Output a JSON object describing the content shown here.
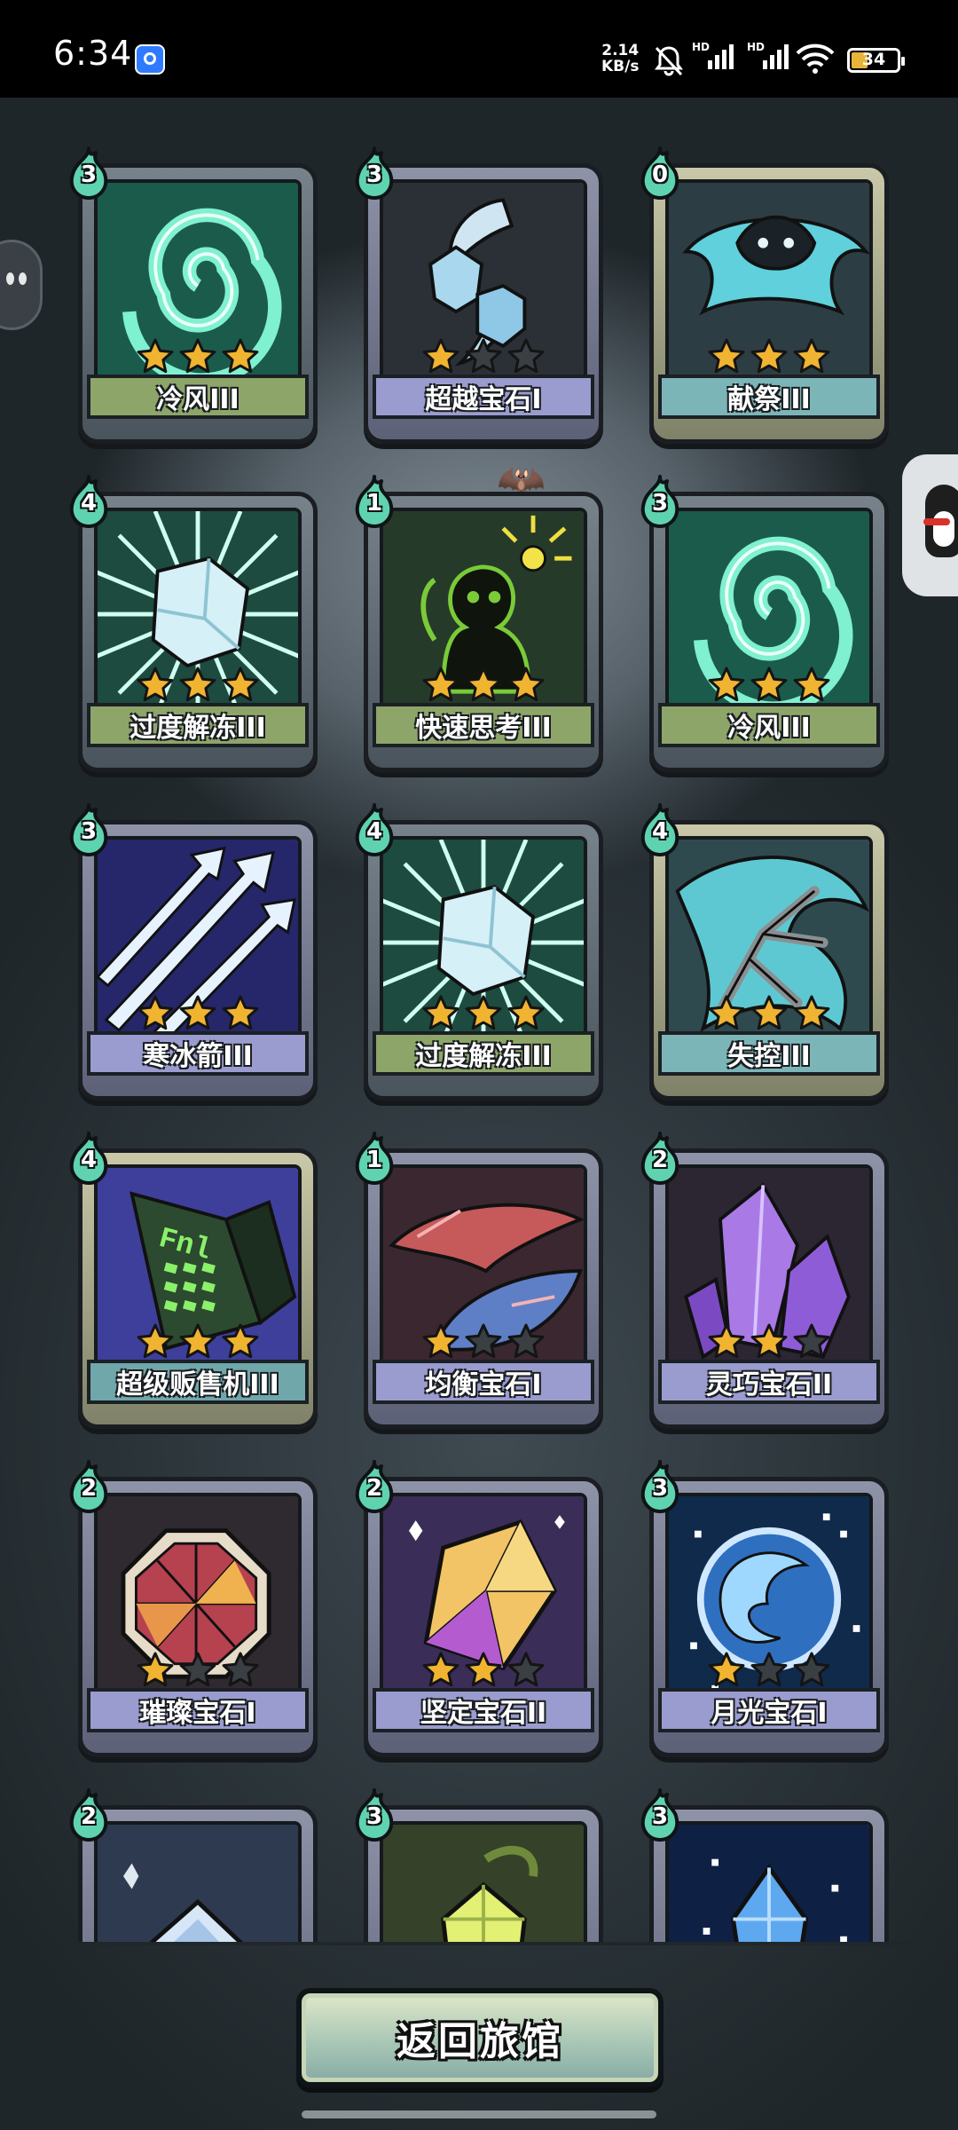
{
  "status_bar": {
    "time": "6:34",
    "net_speed_value": "2.14",
    "net_speed_unit": "KB/s",
    "signal_labels": [
      "HD",
      "HD"
    ],
    "battery_level": "34"
  },
  "cards": [
    {
      "name": "冷风III",
      "cost": "3",
      "stars": 3,
      "max_stars": 3,
      "rarity": "green",
      "art": "vortex"
    },
    {
      "name": "超越宝石I",
      "cost": "3",
      "stars": 1,
      "max_stars": 3,
      "rarity": "purple",
      "art": "gem-pair"
    },
    {
      "name": "献祭III",
      "cost": "0",
      "stars": 3,
      "max_stars": 3,
      "rarity": "gold",
      "art": "spirit"
    },
    {
      "name": "过度解冻III",
      "cost": "4",
      "stars": 3,
      "max_stars": 3,
      "rarity": "green",
      "art": "ice-cube"
    },
    {
      "name": "快速思考III",
      "cost": "1",
      "stars": 3,
      "max_stars": 3,
      "rarity": "green",
      "art": "thinker"
    },
    {
      "name": "冷风III",
      "cost": "3",
      "stars": 3,
      "max_stars": 3,
      "rarity": "green",
      "art": "vortex"
    },
    {
      "name": "寒冰箭III",
      "cost": "3",
      "stars": 3,
      "max_stars": 3,
      "rarity": "purple",
      "art": "ice-arrows"
    },
    {
      "name": "过度解冻III",
      "cost": "4",
      "stars": 3,
      "max_stars": 3,
      "rarity": "green",
      "art": "ice-cube"
    },
    {
      "name": "失控III",
      "cost": "4",
      "stars": 3,
      "max_stars": 3,
      "rarity": "gold",
      "art": "claw"
    },
    {
      "name": "超级贩售机III",
      "cost": "4",
      "stars": 3,
      "max_stars": 3,
      "rarity": "gold-teal",
      "art": "vending"
    },
    {
      "name": "均衡宝石I",
      "cost": "1",
      "stars": 1,
      "max_stars": 3,
      "rarity": "purple",
      "art": "balance-gem"
    },
    {
      "name": "灵巧宝石II",
      "cost": "2",
      "stars": 2,
      "max_stars": 3,
      "rarity": "purple",
      "art": "crystal"
    },
    {
      "name": "璀璨宝石I",
      "cost": "2",
      "stars": 1,
      "max_stars": 3,
      "rarity": "purple",
      "art": "octagon-gem"
    },
    {
      "name": "坚定宝石II",
      "cost": "2",
      "stars": 2,
      "max_stars": 3,
      "rarity": "purple",
      "art": "gold-gem"
    },
    {
      "name": "月光宝石I",
      "cost": "3",
      "stars": 1,
      "max_stars": 3,
      "rarity": "purple",
      "art": "moon-gem"
    },
    {
      "name": "",
      "cost": "2",
      "stars": 0,
      "max_stars": 0,
      "rarity": "purple",
      "art": "shield-gem"
    },
    {
      "name": "",
      "cost": "3",
      "stars": 0,
      "max_stars": 0,
      "rarity": "purple",
      "art": "yellow-gem"
    },
    {
      "name": "",
      "cost": "3",
      "stars": 0,
      "max_stars": 0,
      "rarity": "purple",
      "art": "blue-crystal"
    }
  ],
  "return_button": {
    "label": "返回旅馆"
  },
  "colors": {
    "star_filled": "#f0b431",
    "star_empty": "#3a3f44",
    "cost_drop": "#5fd3b0",
    "green_plate": "#8ea56a",
    "purple_plate": "#9a9ccf",
    "teal_plate": "#7cb5b8"
  }
}
